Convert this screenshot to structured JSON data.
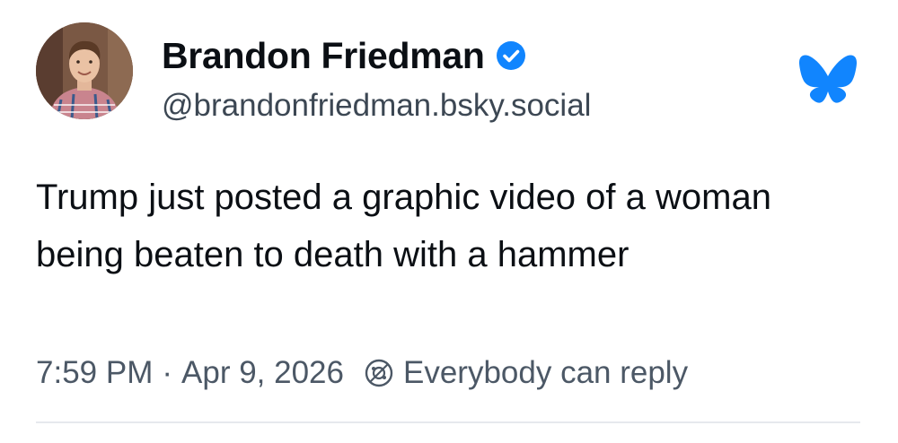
{
  "author": {
    "display_name": "Brandon Friedman",
    "handle": "@brandonfriedman.bsky.social",
    "verified_icon": "verified-check-icon",
    "avatar": "profile-photo"
  },
  "platform": {
    "logo_icon": "bluesky-butterfly-icon",
    "accent_color": "#1185fe"
  },
  "post": {
    "text": "Trump just posted a graphic video of a woman being beaten to death with a hammer",
    "time": "7:59 PM",
    "separator": "·",
    "date": "Apr 9, 2026",
    "reply_icon": "reply-restriction-icon",
    "reply_setting": "Everybody can reply"
  }
}
